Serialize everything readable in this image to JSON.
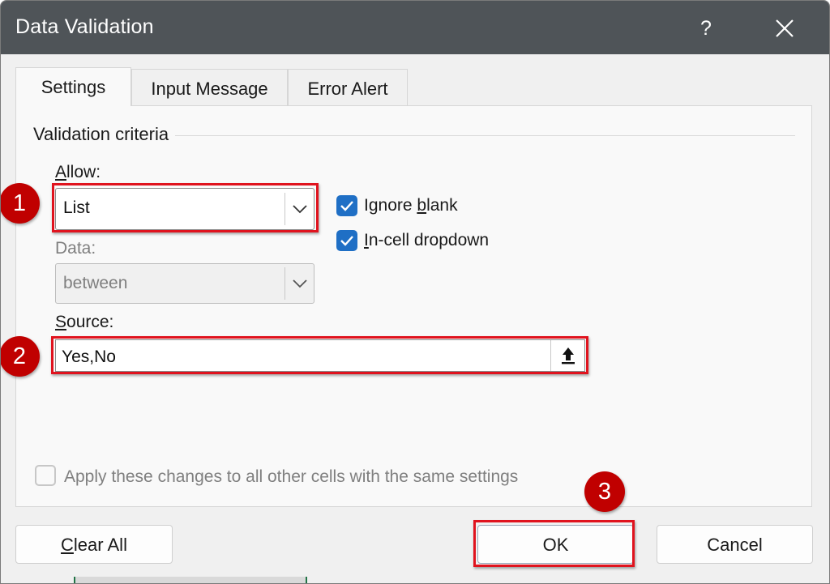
{
  "window": {
    "title": "Data Validation",
    "help_label": "?"
  },
  "tabs": [
    {
      "label": "Settings",
      "active": true
    },
    {
      "label": "Input Message",
      "active": false
    },
    {
      "label": "Error Alert",
      "active": false
    }
  ],
  "settings": {
    "group_label": "Validation criteria",
    "allow": {
      "label_prefix": "",
      "label_mnemonic": "A",
      "label_rest": "llow:",
      "value": "List"
    },
    "data": {
      "label": "Data:",
      "value": "between"
    },
    "ignore_blank": {
      "label_prefix": "Ignore ",
      "label_mnemonic": "b",
      "label_rest": "lank",
      "checked": true
    },
    "in_cell_dropdown": {
      "label_mnemonic": "I",
      "label_rest": "n-cell dropdown",
      "checked": true
    },
    "source": {
      "label_mnemonic": "S",
      "label_rest": "ource:",
      "value": "Yes,No"
    },
    "apply_all": {
      "label": "Apply these changes to all other cells with the same settings",
      "checked": false
    }
  },
  "buttons": {
    "clear_all_mnemonic": "C",
    "clear_all_rest": "lear All",
    "ok": "OK",
    "cancel": "Cancel"
  },
  "annotations": {
    "marker_1": "1",
    "marker_2": "2",
    "marker_3": "3",
    "highlight_color": "#e0131e",
    "marker_color": "#c00000"
  },
  "colors": {
    "titlebar": "#4f5458",
    "checkbox_checked": "#1f6fc5",
    "dialog_background": "#f0f0f0"
  },
  "icons": {
    "close": "close-icon",
    "dropdown": "chevron-down-icon",
    "check": "checkmark-icon",
    "collapse": "collapse-dialog-icon"
  }
}
